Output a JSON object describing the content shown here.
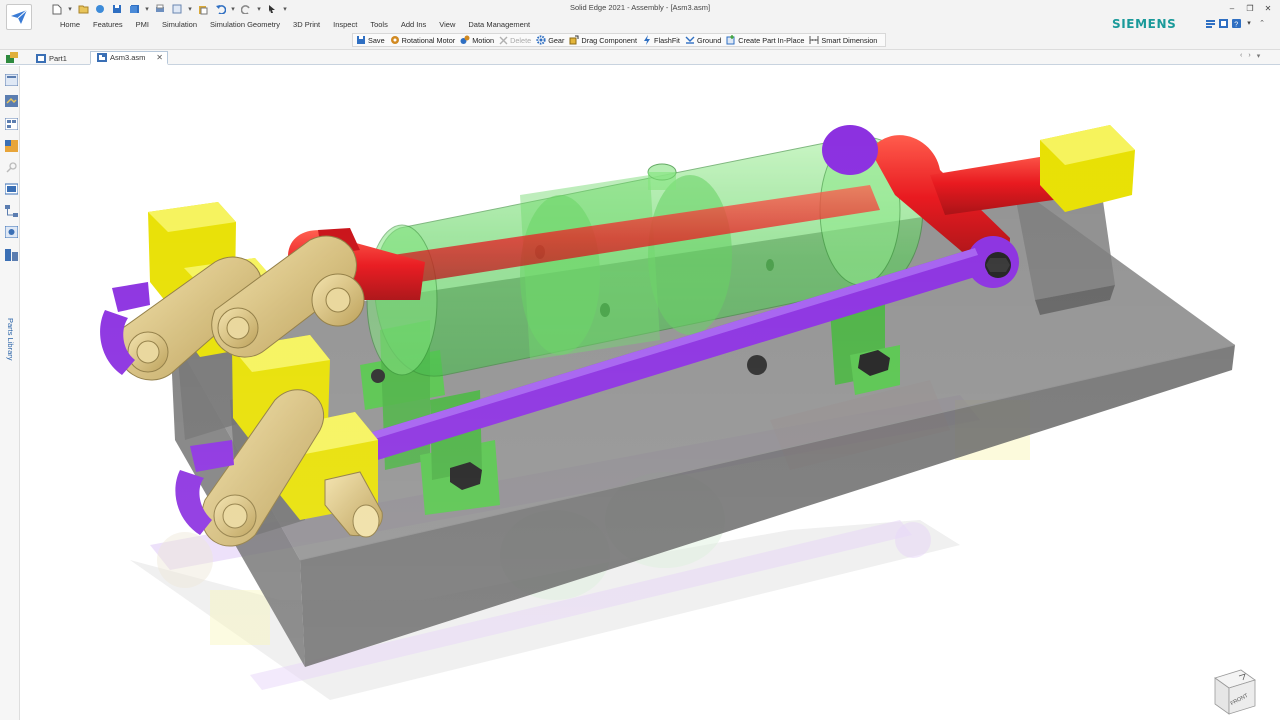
{
  "window": {
    "title": "Solid Edge 2021 - Assembly - [Asm3.asm]",
    "brand": "SIEMENS"
  },
  "menu": [
    "Home",
    "Features",
    "PMI",
    "Simulation",
    "Simulation Geometry",
    "3D Print",
    "Inspect",
    "Tools",
    "Add Ins",
    "View",
    "Data Management"
  ],
  "commands": {
    "save": "Save",
    "rotational_motor": "Rotational Motor",
    "motion": "Motion",
    "delete": "Delete",
    "gear": "Gear",
    "drag_component": "Drag Component",
    "flashfit": "FlashFit",
    "ground": "Ground",
    "create_part": "Create Part In-Place",
    "smart_dimension": "Smart Dimension"
  },
  "tabs": {
    "part1": "Part1",
    "asm3": "Asm3.asm"
  },
  "sidebar": {
    "parts_library": "Parts Library"
  },
  "viewcube": {
    "face": "FRONT"
  },
  "colors": {
    "base": "#6e6e6e",
    "cylinder": "#62d462",
    "rod": "#e8141a",
    "link_bar": "#8a2ee0",
    "bearing_block": "#e8e000",
    "bronze": "#d8c07a",
    "bolt": "#1f1f1f"
  }
}
